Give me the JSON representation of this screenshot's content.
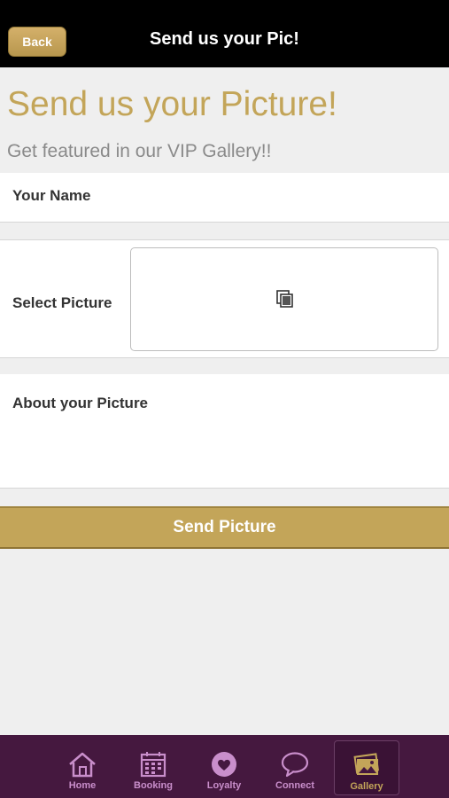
{
  "header": {
    "back_label": "Back",
    "title": "Send us your Pic!"
  },
  "page": {
    "heading": "Send us your Picture!",
    "subheading": "Get featured in our VIP Gallery!!"
  },
  "form": {
    "name_label": "Your Name",
    "picture_label": "Select Picture",
    "about_label": "About your Picture",
    "submit_label": "Send Picture"
  },
  "tabs": [
    {
      "label": "Home",
      "icon": "home-icon"
    },
    {
      "label": "Booking",
      "icon": "calendar-icon"
    },
    {
      "label": "Loyalty",
      "icon": "heart-icon"
    },
    {
      "label": "Connect",
      "icon": "chat-bubble-icon"
    },
    {
      "label": "Gallery",
      "icon": "pictures-icon",
      "active": true
    }
  ],
  "colors": {
    "accent_gold": "#c3a559",
    "tab_bar_purple": "#45183f",
    "tab_icon_pink": "#c98ecb",
    "header_black": "#000000"
  }
}
